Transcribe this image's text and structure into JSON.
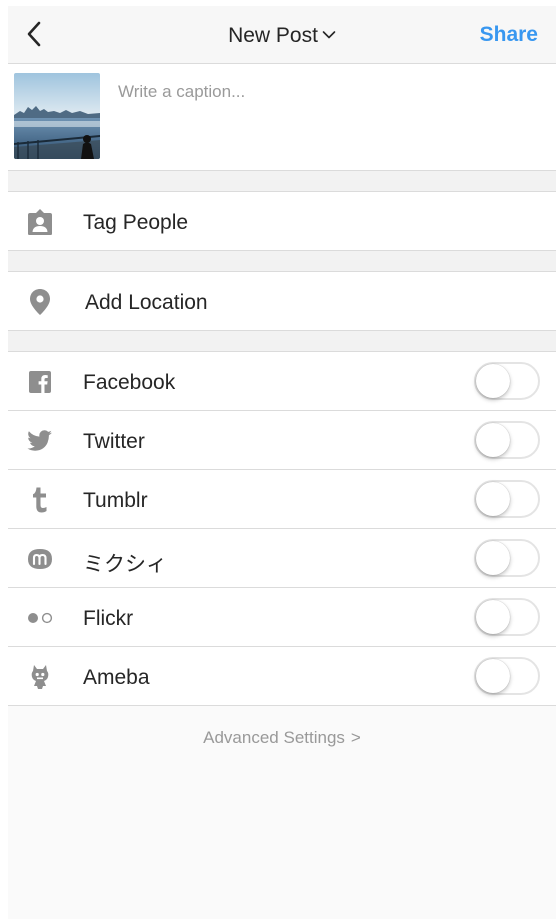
{
  "header": {
    "title": "New Post",
    "share_label": "Share",
    "back_icon": "chevron-left-icon",
    "title_icon": "chevron-down-icon",
    "accent_color": "#3897f0"
  },
  "caption": {
    "placeholder": "Write a caption...",
    "value": ""
  },
  "options": {
    "tag_people": {
      "label": "Tag People",
      "icon": "person-tag-icon"
    },
    "add_location": {
      "label": "Add Location",
      "icon": "location-pin-icon"
    }
  },
  "share_targets": [
    {
      "label": "Facebook",
      "icon": "facebook-icon",
      "enabled": false
    },
    {
      "label": "Twitter",
      "icon": "twitter-icon",
      "enabled": false
    },
    {
      "label": "Tumblr",
      "icon": "tumblr-icon",
      "enabled": false
    },
    {
      "label": "ミクシィ",
      "icon": "mixi-icon",
      "enabled": false
    },
    {
      "label": "Flickr",
      "icon": "flickr-icon",
      "enabled": false
    },
    {
      "label": "Ameba",
      "icon": "ameba-icon",
      "enabled": false
    }
  ],
  "footer": {
    "advanced_label": "Advanced Settings",
    "advanced_arrow": ">"
  }
}
